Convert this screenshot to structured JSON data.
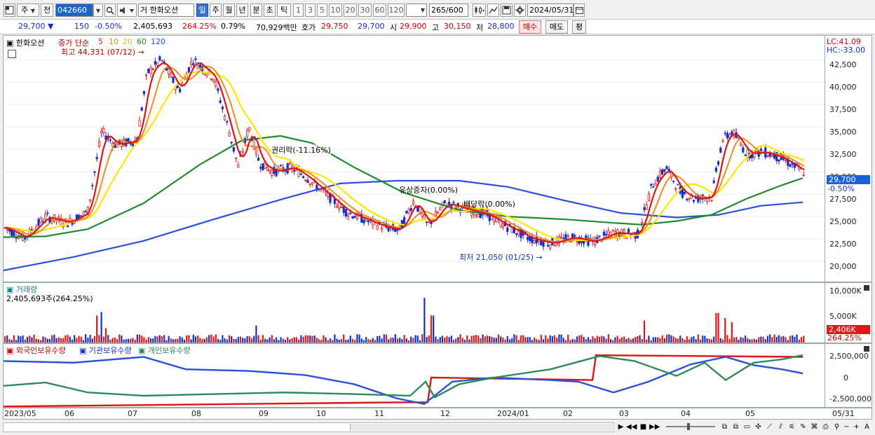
{
  "toolbar": {
    "market_label": "주",
    "prev_label": "전",
    "code_value": "042660",
    "stock_name": "거 한화오션",
    "periods": [
      "일",
      "주",
      "월",
      "년",
      "분",
      "초",
      "틱"
    ],
    "selected_period": "일",
    "intervals": [
      "1",
      "3",
      "5",
      "10",
      "20",
      "30",
      "60",
      "120"
    ],
    "count_value": "265",
    "count_total": "/600",
    "date_value": "2024/05/31"
  },
  "quote": {
    "price": "29,700",
    "change": "150",
    "change_pct": "-0.50%",
    "volume": "2,405,693",
    "volume_ratio": "264.25%",
    "turnover": "0.79%",
    "amount": "70,929백만",
    "bid_label": "호가",
    "bid1": "29,750",
    "bid2": "29,700",
    "open_label": "시",
    "open": "29,900",
    "high_label": "고",
    "high": "30,150",
    "low_label": "저",
    "low": "28,800",
    "buy_label": "매수",
    "sell_label": "매도",
    "eval_label": "평"
  },
  "price_panel": {
    "stock_tag": "한화오션",
    "legend_title": "종가 단순",
    "ma_periods": [
      "5",
      "10",
      "20",
      "60",
      "120"
    ],
    "ma_colors": [
      "#dc1414",
      "#f08c1e",
      "#ffe600",
      "#1e8c28",
      "#2850dc"
    ],
    "high_note": "최고 44,331 (07/12)",
    "low_note": "최저 21,050 (01/25)",
    "event_rights": "권리락(-11.16%)",
    "event_capital": "유상증자(0.00%)",
    "event_dividend": "배당락(0.00%)",
    "lc": "LC:41.09",
    "hc": "HC:-33.00",
    "y_ticks": [
      "42,500",
      "40,000",
      "37,500",
      "35,000",
      "32,500",
      "30,000",
      "27,500",
      "25,000",
      "22,500",
      "20,000"
    ],
    "last_price": "29,700",
    "last_pct": "-0.50%"
  },
  "volume_panel": {
    "title": "거래량",
    "value": "2,405,693주(264.25%)",
    "y_ticks": [
      "10,000K",
      "5,000K"
    ],
    "last_value": "2,406K",
    "last_pct": "264.25%"
  },
  "holding_panel": {
    "series": [
      {
        "name": "외국인보유수량",
        "color": "#dc1414"
      },
      {
        "name": "기관보유수량",
        "color": "#2850dc"
      },
      {
        "name": "개인보유수량",
        "color": "#2e8b57"
      }
    ],
    "y_ticks": [
      "2,500,000",
      "0",
      "-2,500,000"
    ]
  },
  "x_axis": {
    "labels": [
      "2023/05",
      "06",
      "07",
      "08",
      "09",
      "10",
      "11",
      "12",
      "2024/01",
      "02",
      "03",
      "04",
      "05"
    ],
    "end_label": "05/31"
  }
}
